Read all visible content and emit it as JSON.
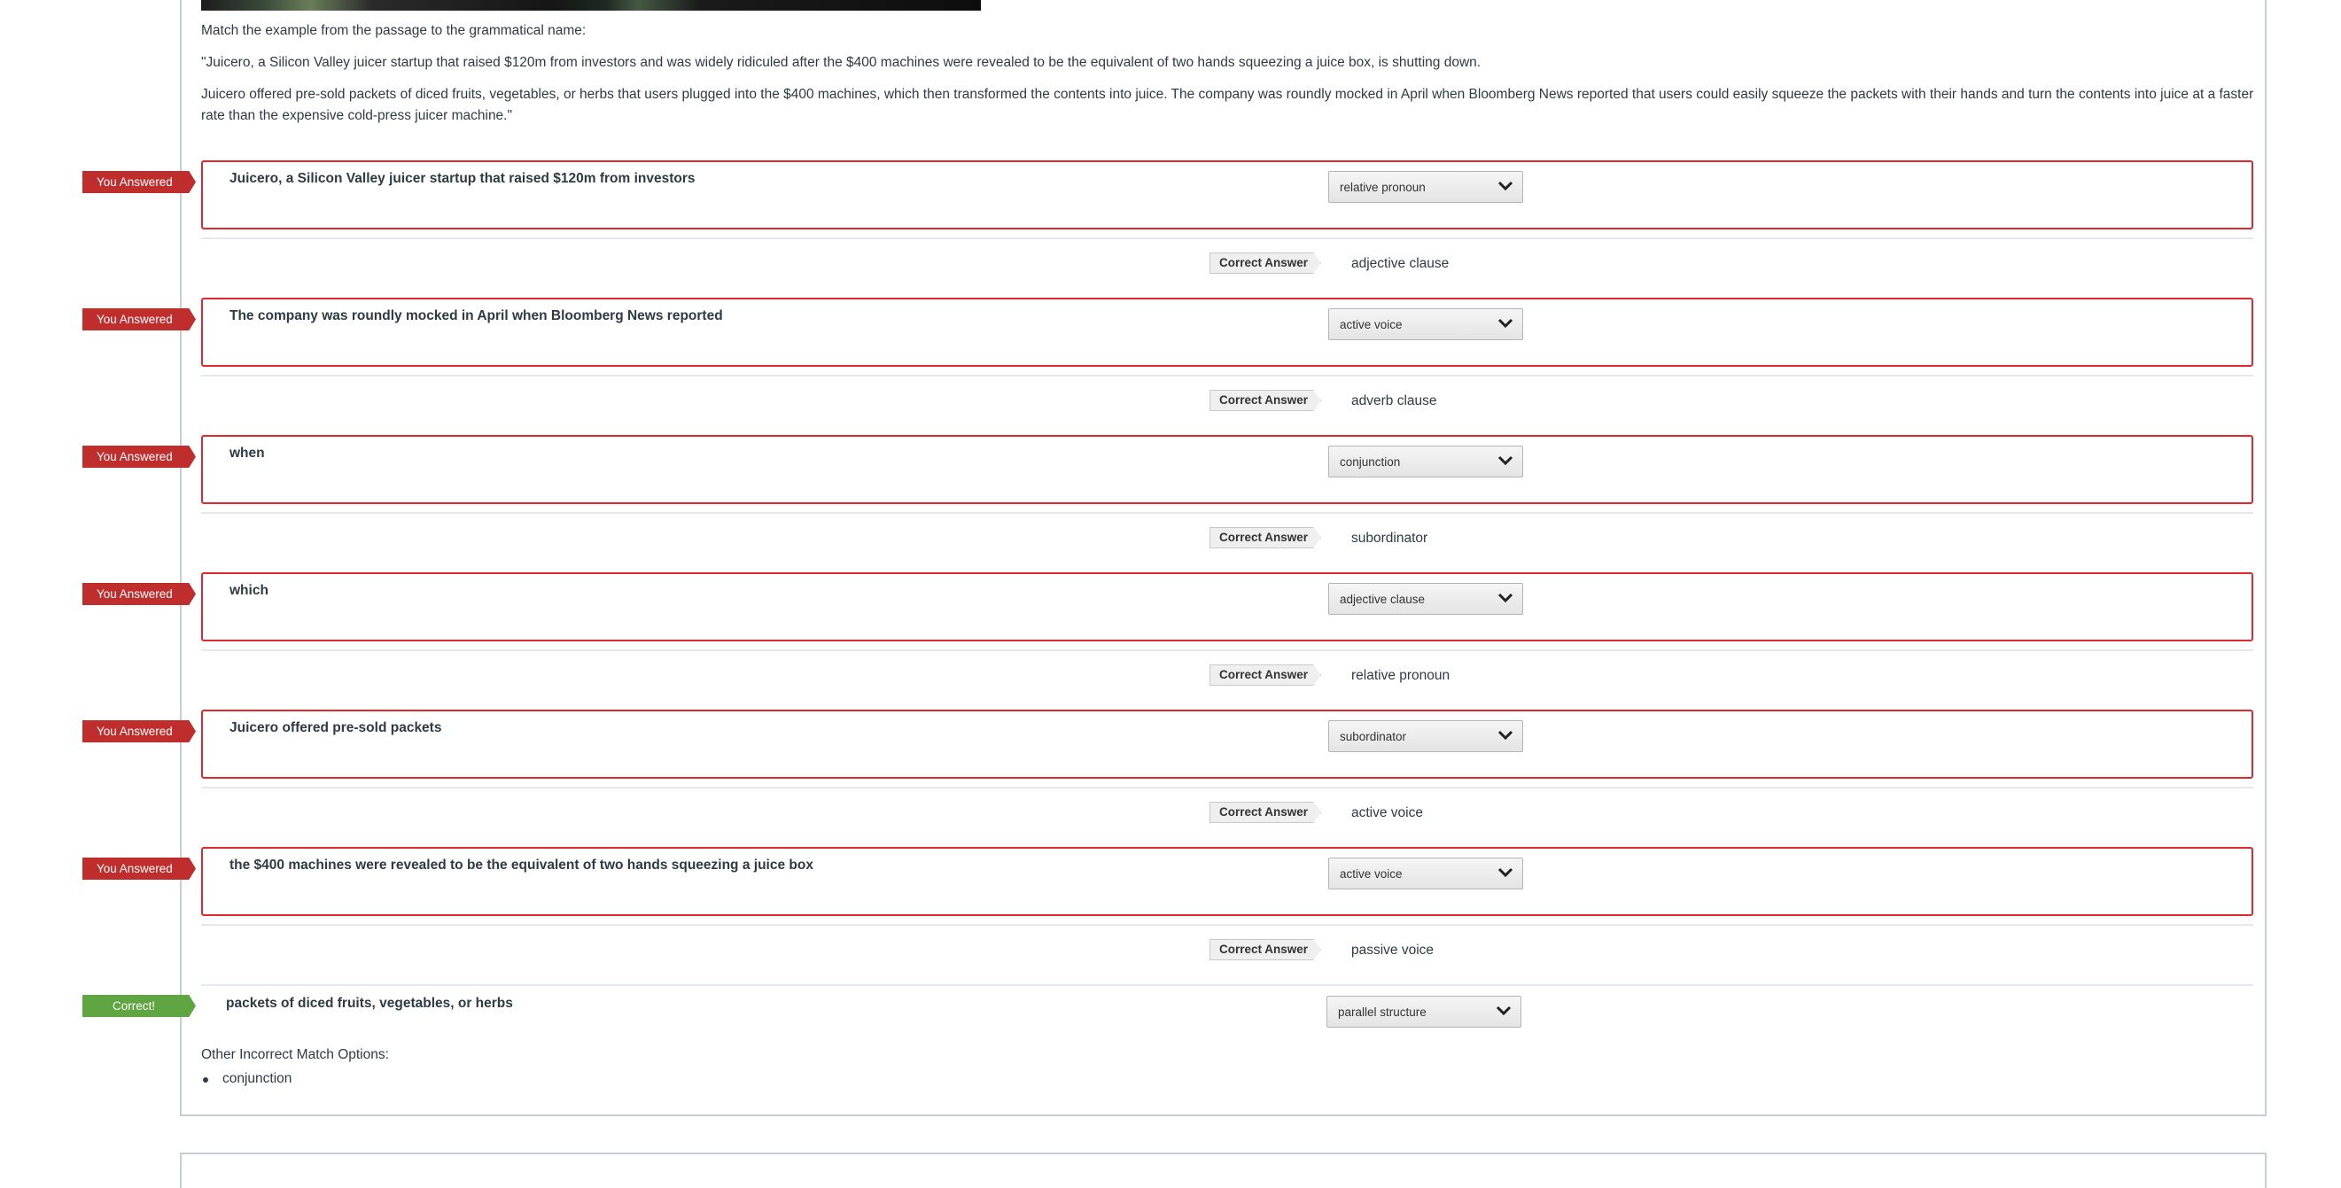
{
  "quiz": {
    "instructions": "Match the example from the passage to the grammatical name:",
    "passage_p1": "\"Juicero, a Silicon Valley juicer startup that raised $120m from investors and was widely ridiculed after the $400 machines were revealed to be the equivalent of two hands squeezing a juice box, is shutting down.",
    "passage_p2": "Juicero offered pre-sold packets of diced fruits, vegetables, or herbs that users plugged into the $400 machines, which then transformed the contents into juice. The company was roundly mocked in April when Bloomberg News reported that users could easily squeeze the packets with their hands and turn the contents into juice at a faster rate than the expensive cold-press juicer machine.\"",
    "you_answered_label": "You Answered",
    "correct_answer_label": "Correct Answer",
    "correct_flag_label": "Correct!",
    "matches": [
      {
        "prompt": "Juicero, a Silicon Valley juicer startup that raised $120m from investors",
        "selected": "relative pronoun",
        "correct": "adjective clause"
      },
      {
        "prompt": "The company was roundly mocked in April when Bloomberg News reported",
        "selected": "active voice",
        "correct": "adverb clause"
      },
      {
        "prompt": "when",
        "selected": "conjunction",
        "correct": "subordinator"
      },
      {
        "prompt": "which",
        "selected": "adjective clause",
        "correct": "relative pronoun"
      },
      {
        "prompt": "Juicero offered pre-sold packets",
        "selected": "subordinator",
        "correct": "active voice"
      },
      {
        "prompt": "the $400 machines were revealed to be the equivalent of two hands squeezing a juice box",
        "selected": "active voice",
        "correct": "passive voice"
      }
    ],
    "correct_match": {
      "prompt": "packets of diced fruits, vegetables, or herbs",
      "selected": "parallel structure"
    },
    "other_options_title": "Other Incorrect Match Options:",
    "other_options": [
      "conjunction"
    ]
  },
  "colors": {
    "wrong": "#bf2d2d",
    "right": "#5fa542",
    "wrong_border": "#e0292f"
  },
  "icons": {
    "dropdown": "chevron-down-icon"
  }
}
